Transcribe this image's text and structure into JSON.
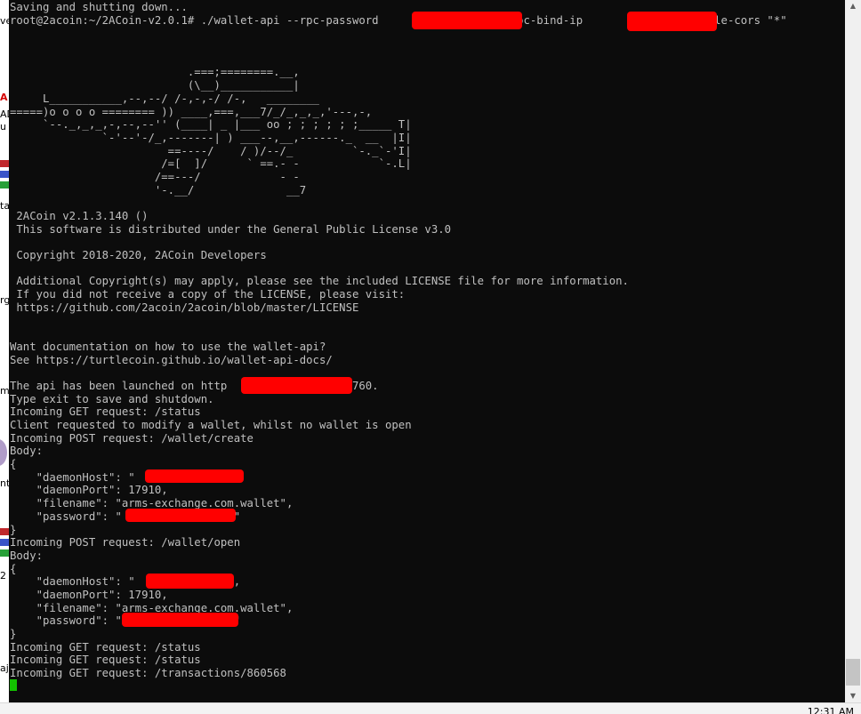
{
  "terminal": {
    "lines": [
      "Saving and shutting down...",
      "root@2acoin:~/2ACoin-v2.0.1# ./wallet-api --rpc-password                  --rpc-bind-ip              --enable-cors \"*\"",
      "",
      "",
      "",
      "                           .===;========.__,",
      "                           (\\__)___________|",
      "     L___________,--,--/ /-,-,-/ /-,   ________",
      "=====)o o o o ======== )) ____,===,___7/_/_,_,_,'---,-,",
      "     `--._,_,_,-,--,--'' (____| _ |___ oo ; ; ; ; ; ;_____ T|",
      "              `-'--'-/_,-------| ) ___--,__,------._  __  |I|",
      "                        ==----/    / )/--/_         `-._`-'I|",
      "                       /=[  ]/      ` ==.- -            `-.L|",
      "                      /==---/            - -",
      "                      '-.__/              __7",
      "",
      " 2ACoin v2.1.3.140 ()",
      " This software is distributed under the General Public License v3.0",
      "",
      " Copyright 2018-2020, 2ACoin Developers",
      "",
      " Additional Copyright(s) may apply, please see the included LICENSE file for more information.",
      " If you did not receive a copy of the LICENSE, please visit:",
      " https://github.com/2acoin/2acoin/blob/master/LICENSE",
      "",
      "",
      "Want documentation on how to use the wallet-api?",
      "See https://turtlecoin.github.io/wallet-api-docs/",
      "",
      "The api has been launched on http                :17760.",
      "Type exit to save and shutdown.",
      "Incoming GET request: /status",
      "Client requested to modify a wallet, whilst no wallet is open",
      "Incoming POST request: /wallet/create",
      "Body:",
      "{",
      "    \"daemonHost\": \"",
      "    \"daemonPort\": 17910,",
      "    \"filename\": \"arms-exchange.com.wallet\",",
      "    \"password\": \"                 \"",
      "}",
      "Incoming POST request: /wallet/open",
      "Body:",
      "{",
      "    \"daemonHost\": \"              \",",
      "    \"daemonPort\": 17910,",
      "    \"filename\": \"arms-exchange.com.wallet\",",
      "    \"password\": \"                 \"",
      "}",
      "Incoming GET request: /status",
      "Incoming GET request: /status",
      "Incoming GET request: /transactions/860568"
    ]
  },
  "left_strip": {
    "fragments": [
      "ve",
      "A",
      "AD",
      "u",
      "ta",
      "rg",
      "mi",
      "nt",
      "2",
      "aj"
    ]
  },
  "taskbar": {
    "clock": "12:31 AM"
  },
  "colors": {
    "terminal_bg": "#0c0c0c",
    "terminal_fg": "#c0c0c0",
    "redaction": "#ff0000",
    "cursor": "#13c200"
  }
}
